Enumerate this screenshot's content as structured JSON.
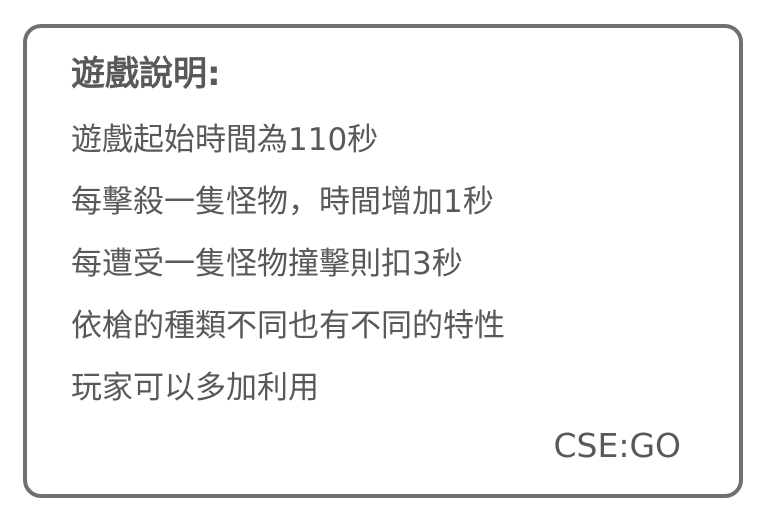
{
  "instructions": {
    "title": "遊戲說明:",
    "lines": [
      "遊戲起始時間為110秒",
      "每擊殺一隻怪物，時間增加1秒",
      "每遭受一隻怪物撞擊則扣3秒",
      "依槍的種類不同也有不同的特性",
      "玩家可以多加利用"
    ],
    "signature": "CSE:GO"
  },
  "colors": {
    "text": "#595959",
    "border": "#707070",
    "background": "#ffffff"
  }
}
